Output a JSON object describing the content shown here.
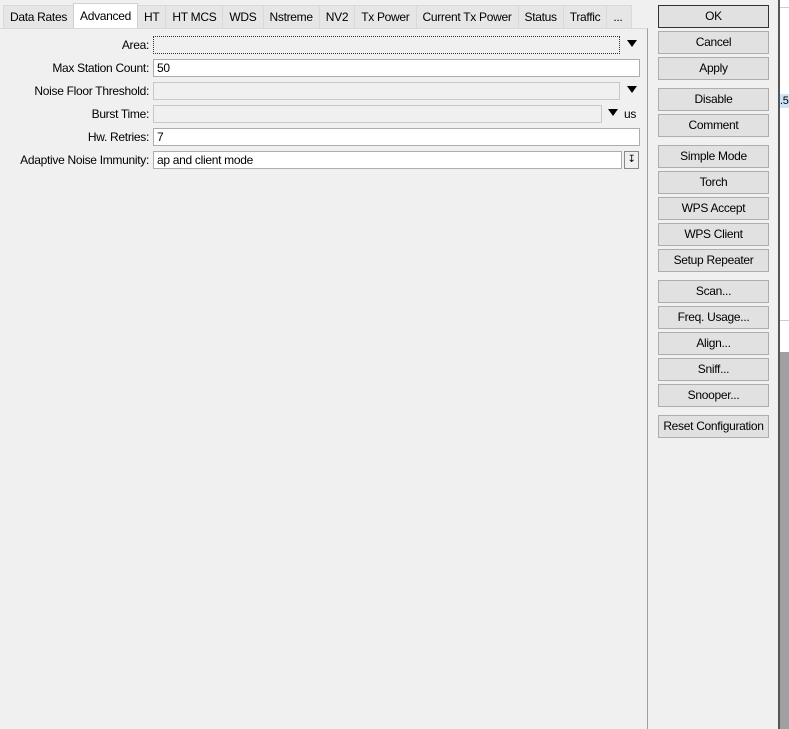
{
  "tabs": [
    "Data Rates",
    "Advanced",
    "HT",
    "HT MCS",
    "WDS",
    "Nstreme",
    "NV2",
    "Tx Power",
    "Current Tx Power",
    "Status",
    "Traffic",
    "..."
  ],
  "active_tab": "Advanced",
  "fields": {
    "area": {
      "label": "Area:",
      "value": ""
    },
    "max_station_count": {
      "label": "Max Station Count:",
      "value": "50"
    },
    "noise_floor_threshold": {
      "label": "Noise Floor Threshold:",
      "value": ""
    },
    "burst_time": {
      "label": "Burst Time:",
      "value": "",
      "unit": "us"
    },
    "hw_retries": {
      "label": "Hw. Retries:",
      "value": "7"
    },
    "adaptive_noise_immunity": {
      "label": "Adaptive Noise Immunity:",
      "value": "ap and client mode"
    }
  },
  "buttons": [
    "OK",
    "Cancel",
    "Apply",
    "Disable",
    "Comment",
    "Simple Mode",
    "Torch",
    "WPS Accept",
    "WPS Client",
    "Setup Repeater",
    "Scan...",
    "Freq. Usage...",
    "Align...",
    "Sniff...",
    "Snooper...",
    "Reset Configuration"
  ],
  "background_window": {
    "visible_text": ".5"
  }
}
